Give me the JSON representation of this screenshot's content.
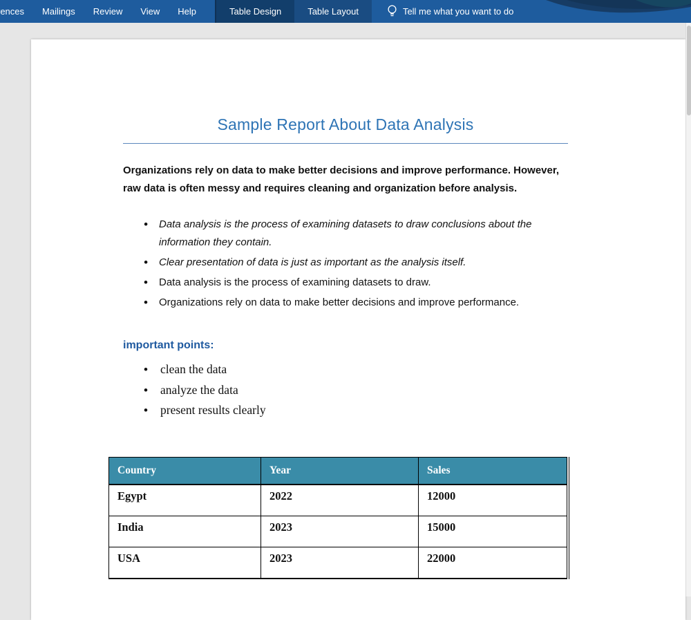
{
  "colors": {
    "ribbon-bg": "#1e5c9e",
    "ribbon-contextual-bg": "#1a4c82",
    "ribbon-active-tab-bg": "#123e6b",
    "title-color": "#2e74b5",
    "heading-color": "#1f5aa0",
    "table-header-bg": "#3a8ca8",
    "workspace-bg": "#e6e6e6"
  },
  "ribbon": {
    "tabs": [
      {
        "label": "rences"
      },
      {
        "label": "Mailings"
      },
      {
        "label": "Review"
      },
      {
        "label": "View"
      },
      {
        "label": "Help"
      }
    ],
    "contextual_tabs": [
      {
        "label": "Table Design",
        "active": true
      },
      {
        "label": "Table Layout",
        "active": false
      }
    ],
    "tell_me": "Tell me what you want to do"
  },
  "document": {
    "title": "Sample Report About Data Analysis",
    "intro": "Organizations rely on data to make better decisions and improve performance. However, raw data is often messy and requires cleaning and organization before analysis.",
    "bullets": [
      {
        "text": "Data analysis is the process of examining datasets to draw conclusions about the information they contain.",
        "italic": true
      },
      {
        "text": "Clear presentation of data is just as important as the analysis itself.",
        "italic": true
      },
      {
        "text": "Data analysis is the process of examining datasets to draw.",
        "italic": false
      },
      {
        "text": "Organizations rely on data to make better decisions and improve performance.",
        "italic": false
      }
    ],
    "heading": "important points:",
    "points": [
      "clean the data",
      "analyze the data",
      "present results clearly"
    ],
    "table": {
      "headers": [
        "Country",
        "Year",
        "Sales"
      ],
      "rows": [
        [
          "Egypt",
          "2022",
          "12000"
        ],
        [
          "India",
          "2023",
          "15000"
        ],
        [
          "USA",
          "2023",
          "22000"
        ]
      ]
    }
  }
}
